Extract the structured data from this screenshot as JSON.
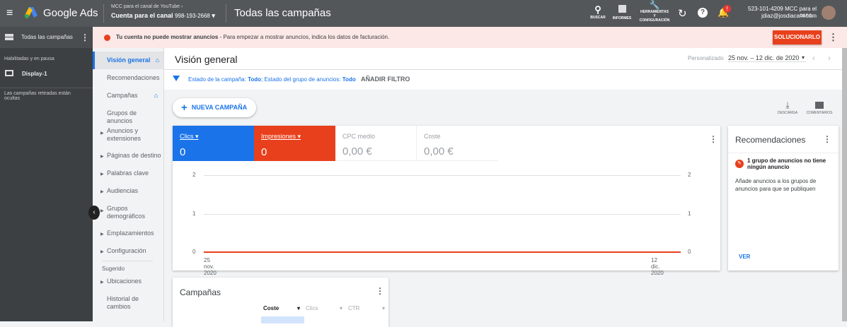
{
  "topbar": {
    "app_name": "Google Ads",
    "account_parent": "MCC para el canal de YouTube",
    "account_name": "Cuenta para el canal",
    "account_id": "998-193-2668",
    "page_title": "Todas las campañas",
    "search_label": "BUSCAR",
    "reports_label": "INFORMES",
    "tools_label_1": "HERRAMIENTAS",
    "tools_label_2": "Y",
    "tools_label_3": "CONFIGURACIÓN",
    "notification_badge": "!",
    "user_account": "523-101-4209 MCC para el cana...",
    "user_email": "jdiaz@josdiacam.com"
  },
  "sidebar": {
    "header": "Todas las campañas",
    "filter_label": "Habilitadas y en pausa",
    "campaign": "Display-1",
    "hidden_note": "Las campañas retiradas están ocultas"
  },
  "alert": {
    "title": "Tu cuenta no puede mostrar anuncios",
    "message": " - Para empezar a mostrar anuncios, indica los datos de facturación.",
    "fix_button": "SOLUCIONARLO"
  },
  "nav": {
    "items": [
      "Visión general",
      "Recomendaciones",
      "Campañas",
      "Grupos de anuncios",
      "Anuncios y extensiones",
      "Páginas de destino",
      "Palabras clave",
      "Audiencias",
      "Grupos demográficos",
      "Emplazamientos",
      "Configuración"
    ],
    "suggested_label": "Sugerido",
    "suggested": [
      "Ubicaciones",
      "Historial de cambios"
    ]
  },
  "header": {
    "title": "Visión general",
    "date_mode": "Personalizado",
    "date_range": "25 nov. – 12 dic. de 2020"
  },
  "filter": {
    "prefix1": "Estado de la campaña: ",
    "val1": "Todo",
    "prefix2": "; Estado del grupo de anuncios: ",
    "val2": "Todo",
    "add": "AÑADIR FILTRO"
  },
  "actions": {
    "new_campaign": "NUEVA CAMPAÑA",
    "download": "DESCARGA",
    "feedback": "COMENTARIOS"
  },
  "metrics": [
    {
      "label": "Clics",
      "value": "0",
      "color": "#1a73e8"
    },
    {
      "label": "Impresiones",
      "value": "0",
      "color": "#e8401c"
    },
    {
      "label": "CPC medio",
      "value": "0,00 €"
    },
    {
      "label": "Coste",
      "value": "0,00 €"
    }
  ],
  "chart_data": {
    "type": "line",
    "x": [
      "25 nov. 2020",
      "12 dic. 2020"
    ],
    "series": [
      {
        "name": "Clics",
        "values": [
          0,
          0
        ]
      },
      {
        "name": "Impresiones",
        "values": [
          0,
          0
        ]
      }
    ],
    "yticks_left": [
      "2",
      "1",
      "0"
    ],
    "yticks_right": [
      "2",
      "1",
      "0"
    ],
    "ylim": [
      0,
      2
    ],
    "grid": true
  },
  "recommendations": {
    "title": "Recomendaciones",
    "item_title": "1 grupo de anuncios no tiene ningún anuncio",
    "item_desc": "Añade anuncios a los grupos de anuncios para que se publiquen",
    "view": "VER"
  },
  "campaigns": {
    "title": "Campañas",
    "columns": [
      "Coste",
      "Clics",
      "CTR"
    ]
  }
}
